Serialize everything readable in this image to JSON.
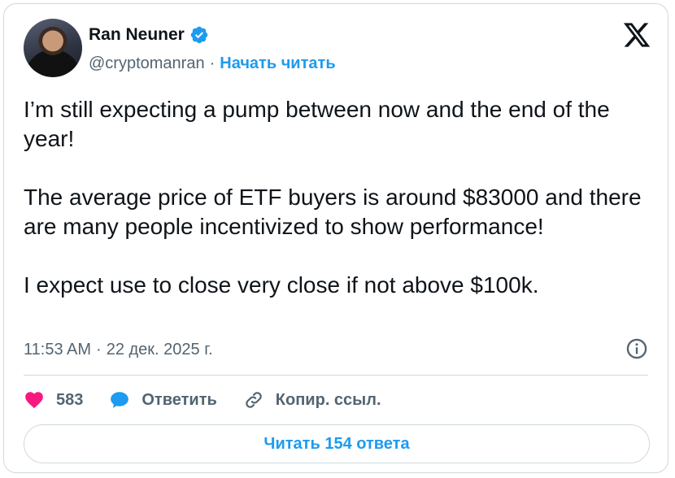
{
  "author": {
    "name": "Ran Neuner",
    "handle": "@cryptomanran",
    "separator": "·",
    "follow_label": "Начать читать",
    "verified": true
  },
  "tweet": {
    "text": "I’m still expecting a pump between now and the end of the year!\n\nThe average price of ETF buyers is around $83000 and there are many people incentivized to show performance!\n\nI expect use to close very close if not above $100k.",
    "time": "11:53 AM",
    "meta_separator": "·",
    "date": "22 дек. 2025 г."
  },
  "actions": {
    "likes_count": "583",
    "reply_label": "Ответить",
    "copy_link_label": "Копир. ссыл."
  },
  "read_replies_label": "Читать 154 ответа",
  "icons": {
    "logo": "x-logo-icon",
    "verified": "verified-badge-icon",
    "info": "info-icon",
    "like": "heart-icon",
    "reply": "speech-bubble-icon",
    "link": "link-icon"
  },
  "colors": {
    "accent": "#1d9bf0",
    "heart": "#f91880",
    "text": "#0f1419",
    "muted": "#536471",
    "border": "#cfd9de"
  }
}
